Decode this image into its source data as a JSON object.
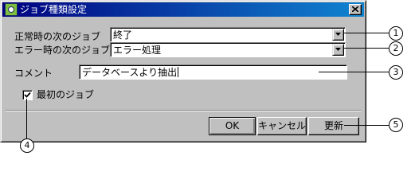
{
  "dialog": {
    "title": "ジョブ種類設定",
    "close_glyph": "×"
  },
  "form": {
    "next_job_normal": {
      "label": "正常時の次のジョブ",
      "value": "終了"
    },
    "next_job_error": {
      "label": "エラー時の次のジョブ",
      "value": "エラー処理"
    },
    "comment": {
      "label": "コメント",
      "value": "データベースより抽出"
    },
    "first_job": {
      "label": "最初のジョブ",
      "checked": true
    }
  },
  "buttons": {
    "ok_label": "OK",
    "cancel_label": "キャンセル",
    "update_label": "更新"
  },
  "callouts": {
    "c1": "1",
    "c2": "2",
    "c3": "3",
    "c4": "4",
    "c5": "5"
  },
  "colors": {
    "titlebar_start": "#000080",
    "titlebar_end": "#1084d0",
    "face": "#c0c0c0"
  }
}
